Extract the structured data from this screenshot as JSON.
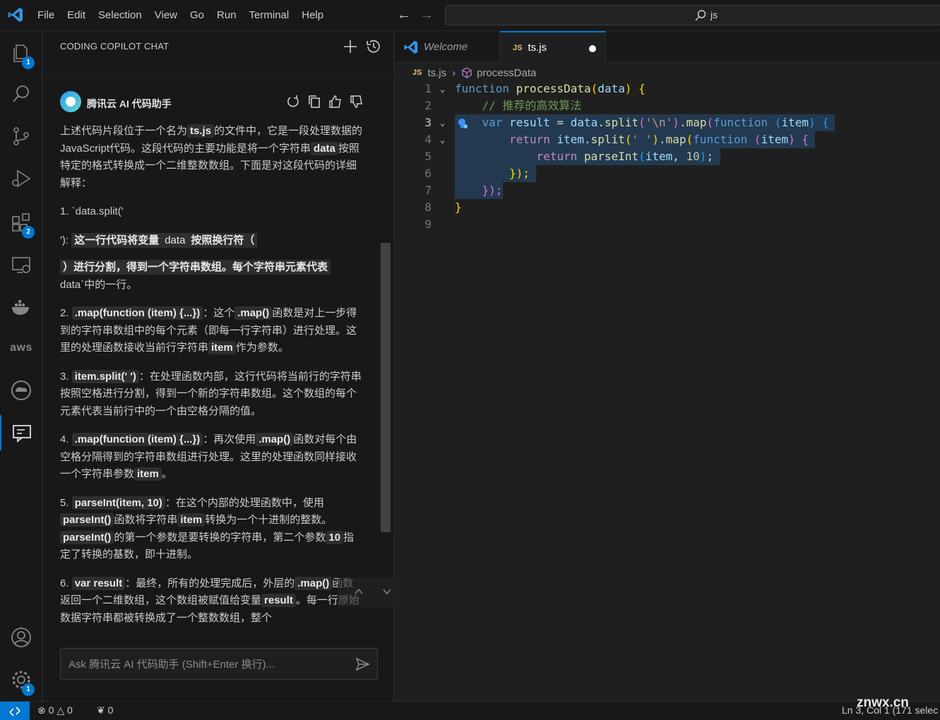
{
  "titlebar": {
    "menu": [
      "File",
      "Edit",
      "Selection",
      "View",
      "Go",
      "Run",
      "Terminal",
      "Help"
    ],
    "search_text": "js"
  },
  "activity": {
    "explorer_badge": "1",
    "extensions_badge": "2",
    "settings_badge": "1",
    "aws_label": "aws"
  },
  "panel": {
    "title": "CODING COPILOT CHAT",
    "agent_name": "腾讯云 AI 代码助手",
    "input_placeholder": "Ask 腾讯云 AI 代码助手 (Shift+Enter 换行)..."
  },
  "chat": {
    "intro": [
      "上述代码片段位于一个名为",
      "ts.js",
      "的文件中，它是一段处理数据的JavaScript代码。这段代码的主要功能是将一个字符串",
      "data",
      "按照特定的格式转换成一个二维整数数组。下面是对这段代码的详细解释："
    ],
    "item1_a": "1. `data.split('",
    "item1_b_pre": "'): ",
    "item1_b_hl": "这一行代码将变量",
    "item1_b_data": "data",
    "item1_b_hl2": "按照换行符（",
    "item1_c_hl": "）进行分割，得到一个字符串数组。每个字符串元素代表",
    "item1_d": "data`中的一行。",
    "item2": [
      "2. ",
      ".map(function (item) {...})",
      "：这个",
      ".map()",
      "函数是对上一步得到的字符串数组中的每个元素（即每一行字符串）进行处理。这里的处理函数接收当前行字符串",
      "item",
      "作为参数。"
    ],
    "item3": [
      "3. ",
      "item.split(' ')",
      "：在处理函数内部，这行代码将当前行的字符串按照空格进行分割，得到一个新的字符串数组。这个数组的每个元素代表当前行中的一个由空格分隔的值。"
    ],
    "item4": [
      "4. ",
      ".map(function (item) {...})",
      "：再次使用",
      ".map()",
      "函数对每个由空格分隔得到的字符串数组进行处理。这里的处理函数同样接收一个字符串参数",
      "item",
      "。"
    ],
    "item5": [
      "5. ",
      "parseInt(item, 10)",
      "：在这个内部的处理函数中，使用",
      "parseInt()",
      "函数将字符串",
      "item",
      "转换为一个十进制的整数。",
      "parseInt()",
      "的第一个参数是要转换的字符串，第二个参数",
      "10",
      "指定了转换的基数，即十进制。"
    ],
    "item6": [
      "6. ",
      "var result",
      "：最终，所有的处理完成后，外层的",
      ".map()",
      "函数返回一个二维数组，这个数组被赋值给变量",
      "result",
      "。每一行原始数据字符串都被转换成了一个整数数组，整个"
    ]
  },
  "editor": {
    "tabs": [
      {
        "label": "Welcome"
      },
      {
        "label": "ts.js",
        "badge": "JS"
      }
    ],
    "breadcrumb": {
      "file": "ts.js",
      "symbol": "processData"
    },
    "line_numbers": [
      "1",
      "2",
      "3",
      "4",
      "5",
      "6",
      "7",
      "8",
      "9"
    ],
    "code": {
      "l1_kw": "function",
      "l1_fn": "processData",
      "l1_p": "data",
      "l1_rest": " {",
      "l2": "// 推荐的高效算法",
      "l3_var": "var",
      "l3_result": "result",
      "l3_eq": " = ",
      "l3_data": "data",
      "l3_split": "split",
      "l3_str": "'\\n'",
      "l3_map": "map",
      "l3_fnkw": "function",
      "l3_item": "item",
      "l4_ret": "return",
      "l4_item": "item",
      "l4_split": "split",
      "l4_str": "' '",
      "l4_map": "map",
      "l4_fnkw": "function",
      "l4_item2": "item",
      "l5_ret": "return",
      "l5_parse": "parseInt",
      "l5_item": "item",
      "l5_num": "10",
      "l6": "});",
      "l7": "});",
      "l8": "}"
    }
  },
  "statusbar": {
    "errors": "0",
    "warnings": "0",
    "ports": "0",
    "position": "Ln 3, Col 1 (171 selec"
  },
  "watermark": "znwx.cn",
  "colors": {
    "accent": "#0078d4",
    "background": "#1f1f1f",
    "sidebar": "#181818"
  }
}
